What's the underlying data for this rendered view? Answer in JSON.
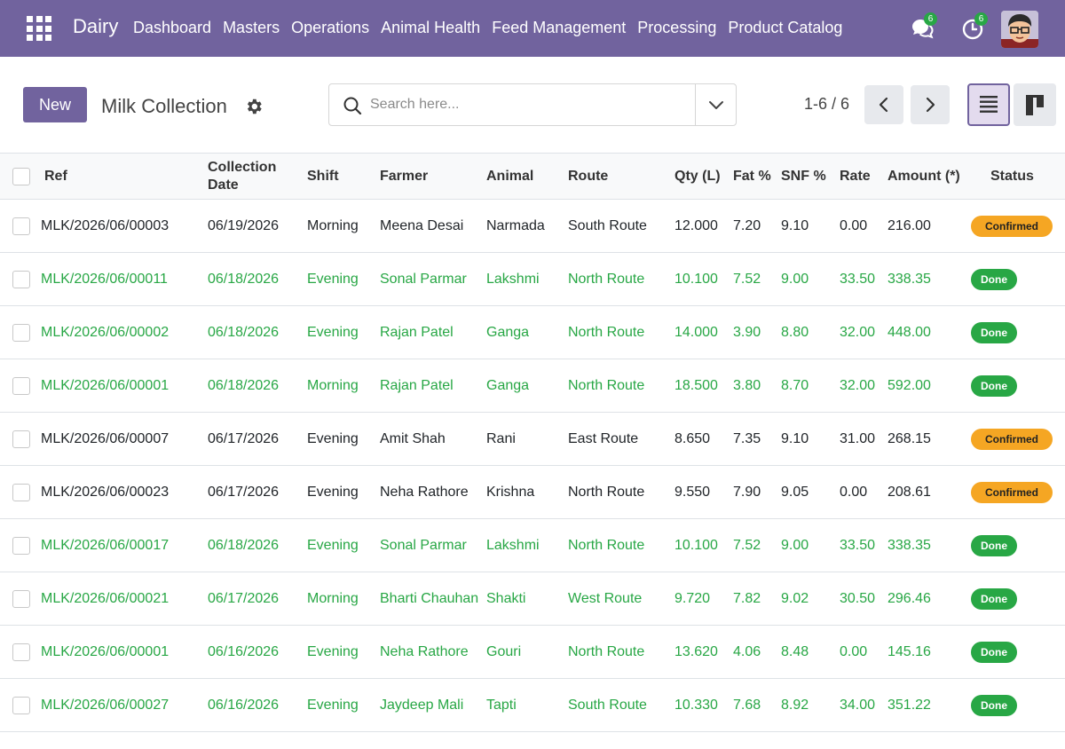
{
  "app": {
    "brand": "Dairy",
    "menu": [
      "Dashboard",
      "Masters",
      "Operations",
      "Animal Health",
      "Feed Management",
      "Processing",
      "Product Catalog"
    ],
    "chat_badge": "6",
    "activity_badge": "6"
  },
  "control": {
    "new_label": "New",
    "title": "Milk Collection",
    "search_placeholder": "Search here...",
    "pager": "1-6 / 6"
  },
  "table": {
    "headers": {
      "ref": "Ref",
      "date": "Collection Date",
      "shift": "Shift",
      "farmer": "Farmer",
      "animal": "Animal",
      "route": "Route",
      "qty": "Qty (L)",
      "fat": "Fat %",
      "snf": "SNF %",
      "rate": "Rate",
      "amount": "Amount (*)",
      "status": "Status"
    },
    "rows": [
      {
        "ref": "MLK/2026/06/00003",
        "date": "06/19/2026",
        "shift": "Morning",
        "farmer": "Meena Desai",
        "animal": "Narmada",
        "route": "South Route",
        "qty": "12.000",
        "fat": "7.20",
        "snf": "9.10",
        "rate": "0.00",
        "amount": "216.00",
        "status": "Confirmed",
        "tone": "dark"
      },
      {
        "ref": "MLK/2026/06/00011",
        "date": "06/18/2026",
        "shift": "Evening",
        "farmer": "Sonal Parmar",
        "animal": "Lakshmi",
        "route": "North Route",
        "qty": "10.100",
        "fat": "7.52",
        "snf": "9.00",
        "rate": "33.50",
        "amount": "338.35",
        "status": "Done",
        "tone": "green"
      },
      {
        "ref": "MLK/2026/06/00002",
        "date": "06/18/2026",
        "shift": "Evening",
        "farmer": "Rajan Patel",
        "animal": "Ganga",
        "route": "North Route",
        "qty": "14.000",
        "fat": "3.90",
        "snf": "8.80",
        "rate": "32.00",
        "amount": "448.00",
        "status": "Done",
        "tone": "green"
      },
      {
        "ref": "MLK/2026/06/00001",
        "date": "06/18/2026",
        "shift": "Morning",
        "farmer": "Rajan Patel",
        "animal": "Ganga",
        "route": "North Route",
        "qty": "18.500",
        "fat": "3.80",
        "snf": "8.70",
        "rate": "32.00",
        "amount": "592.00",
        "status": "Done",
        "tone": "green"
      },
      {
        "ref": "MLK/2026/06/00007",
        "date": "06/17/2026",
        "shift": "Evening",
        "farmer": "Amit Shah",
        "animal": "Rani",
        "route": "East Route",
        "qty": "8.650",
        "fat": "7.35",
        "snf": "9.10",
        "rate": "31.00",
        "amount": "268.15",
        "status": "Confirmed",
        "tone": "dark"
      },
      {
        "ref": "MLK/2026/06/00023",
        "date": "06/17/2026",
        "shift": "Evening",
        "farmer": "Neha Rathore",
        "animal": "Krishna",
        "route": "North Route",
        "qty": "9.550",
        "fat": "7.90",
        "snf": "9.05",
        "rate": "0.00",
        "amount": "208.61",
        "status": "Confirmed",
        "tone": "dark"
      },
      {
        "ref": "MLK/2026/06/00017",
        "date": "06/18/2026",
        "shift": "Evening",
        "farmer": "Sonal Parmar",
        "animal": "Lakshmi",
        "route": "North Route",
        "qty": "10.100",
        "fat": "7.52",
        "snf": "9.00",
        "rate": "33.50",
        "amount": "338.35",
        "status": "Done",
        "tone": "green"
      },
      {
        "ref": "MLK/2026/06/00021",
        "date": "06/17/2026",
        "shift": "Morning",
        "farmer": "Bharti Chauhan",
        "animal": "Shakti",
        "route": "West Route",
        "qty": "9.720",
        "fat": "7.82",
        "snf": "9.02",
        "rate": "30.50",
        "amount": "296.46",
        "status": "Done",
        "tone": "green"
      },
      {
        "ref": "MLK/2026/06/00001",
        "date": "06/16/2026",
        "shift": "Evening",
        "farmer": "Neha Rathore",
        "animal": "Gouri",
        "route": "North Route",
        "qty": "13.620",
        "fat": "4.06",
        "snf": "8.48",
        "rate": "0.00",
        "amount": "145.16",
        "status": "Done",
        "tone": "green"
      },
      {
        "ref": "MLK/2026/06/00027",
        "date": "06/16/2026",
        "shift": "Evening",
        "farmer": "Jaydeep Mali",
        "animal": "Tapti",
        "route": "South Route",
        "qty": "10.330",
        "fat": "7.68",
        "snf": "8.92",
        "rate": "34.00",
        "amount": "351.22",
        "status": "Done",
        "tone": "green"
      }
    ]
  },
  "colors": {
    "brand": "#71639e",
    "done": "#28a745",
    "confirmed": "#f5a623"
  },
  "icons": [
    "apps-icon",
    "chat-icon",
    "activity-clock-icon",
    "gear-icon",
    "search-icon",
    "chevron-down-icon",
    "chevron-left-icon",
    "chevron-right-icon",
    "list-view-icon",
    "kanban-view-icon"
  ]
}
